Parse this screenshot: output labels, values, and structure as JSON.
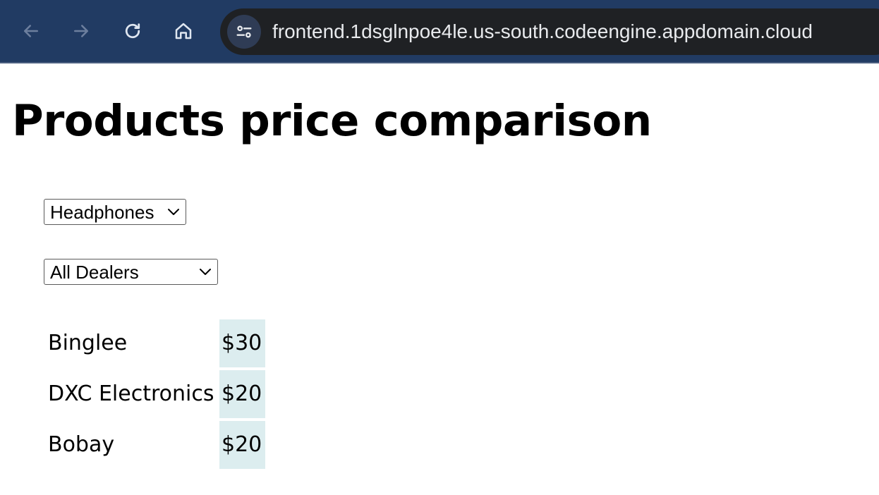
{
  "browser": {
    "url": "frontend.1dsglnpoe4le.us-south.codeengine.appdomain.cloud",
    "icons": [
      "back-icon",
      "forward-icon",
      "reload-icon",
      "home-icon",
      "site-info-icon"
    ]
  },
  "page": {
    "title": "Products price comparison"
  },
  "filters": {
    "product": {
      "selected": "Headphones"
    },
    "dealer": {
      "selected": "All Dealers"
    }
  },
  "prices": [
    {
      "dealer": "Binglee",
      "price": "$30"
    },
    {
      "dealer": "DXC Electronics",
      "price": "$20"
    },
    {
      "dealer": "Bobay",
      "price": "$20"
    }
  ],
  "colors": {
    "toolbar": "#213b63",
    "url_bar": "#1f2124",
    "price_cell": "#dcedef"
  }
}
